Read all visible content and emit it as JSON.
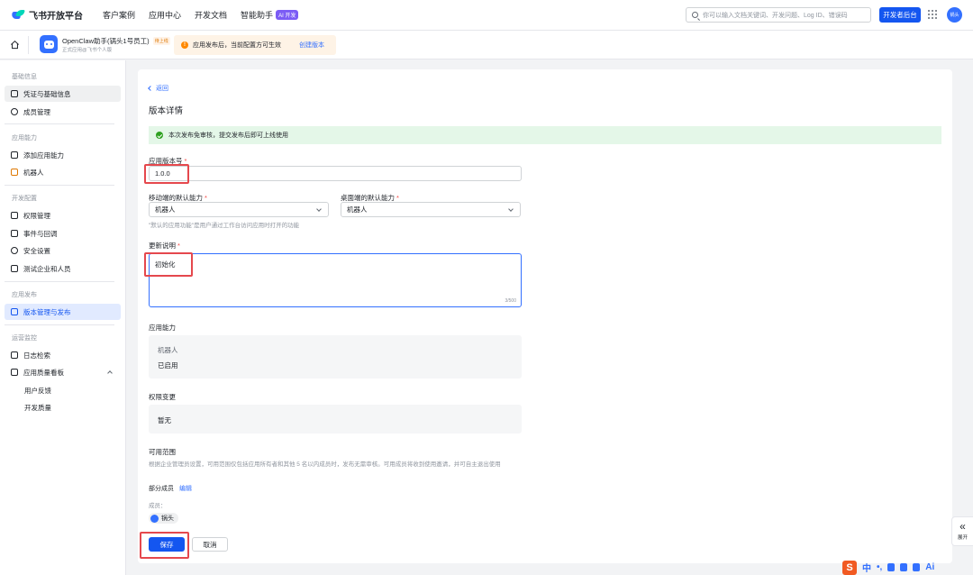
{
  "topnav": {
    "logo_text": "飞书开放平台",
    "links": [
      "客户案例",
      "应用中心",
      "开发文档",
      "智能助手"
    ],
    "ai_badge": "AI 开发",
    "search_placeholder": "你可以输入文档关键词、开发问题、Log ID、错误码",
    "dev_console_button": "开发者后台",
    "avatar_text": "锅头"
  },
  "app_header": {
    "app_name": "OpenClaw助手(锅头1号员工)",
    "status_tag": "待上线",
    "app_subtitle": "正式应用@飞书个人版",
    "notice_text": "应用发布后，当前配置方可生效",
    "notice_link": "创建版本"
  },
  "sidebar": {
    "groups": {
      "basic": "基础信息",
      "capability": "应用能力",
      "dev_config": "开发配置",
      "release": "应用发布",
      "ops": "运营监控"
    },
    "items": {
      "credentials": "凭证与基础信息",
      "members": "成员管理",
      "add_capability": "添加应用能力",
      "bot": "机器人",
      "permissions": "权限管理",
      "events": "事件与回调",
      "security": "安全设置",
      "test_enterprise": "测试企业和人员",
      "version_release": "版本管理与发布",
      "log_search": "日志检索",
      "quality_board": "应用质量看板",
      "user_feedback": "用户反馈",
      "dev_quality": "开发质量"
    }
  },
  "main": {
    "back_label": "返回",
    "title": "版本详情",
    "success_text": "本次发布免审核，提交发布后即可上线使用",
    "version_label": "应用版本号",
    "version_value": "1.0.0",
    "mobile_default_label": "移动端的默认能力",
    "mobile_default_value": "机器人",
    "desktop_default_label": "桌面端的默认能力",
    "desktop_default_value": "机器人",
    "default_hint": "\"默认的应用功能\"是用户通过工作台访问应用时打开的功能",
    "release_notes_label": "更新说明",
    "release_notes_value": "初始化",
    "release_notes_counter": "3/500",
    "capability_label": "应用能力",
    "capability_name": "机器人",
    "capability_status": "已启用",
    "permission_change_label": "权限变更",
    "permission_change_value": "暂无",
    "scope_label": "可用范围",
    "scope_desc": "根据企业管理员设置，可用范围仅包括应用所有者和其他 5 名以内成员时，发布无需审核。可用成员将收到使用邀请，并可自主退出使用",
    "scope_mode": "部分成员",
    "scope_edit": "编辑",
    "members_label": "成员：",
    "member_name": "锅头",
    "save_button": "保存",
    "cancel_button": "取消"
  },
  "float": {
    "expand_label": "展开"
  },
  "ime": {
    "logo": "S",
    "mode": "中",
    "punct": "•,",
    "ai": "Ai"
  }
}
